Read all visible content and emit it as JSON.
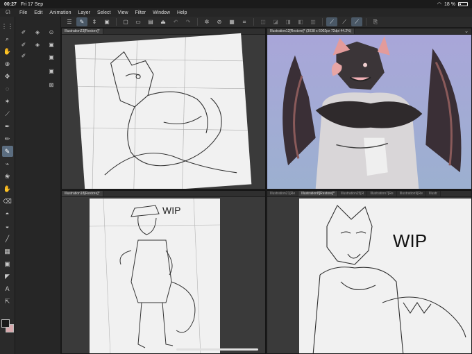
{
  "status": {
    "time": "00:27",
    "date": "Fri 17 Sep",
    "battery": "18 %"
  },
  "menu": [
    "File",
    "Edit",
    "Animation",
    "Layer",
    "Select",
    "View",
    "Filter",
    "Window",
    "Help"
  ],
  "panes": {
    "top_left": {
      "tabs": [
        "Illustration23[Restore]*"
      ]
    },
    "top_right": {
      "tabs": [
        "Illustration12[Restore]* (3038 x 6002px 72dpi 44.2%)"
      ]
    },
    "bottom_left": {
      "tabs": [
        "Illustration18[Restore]*"
      ]
    },
    "bottom_right": {
      "tabs": [
        "Illustration21[Re",
        "Illustration8[Restore]*",
        "Illustration25[R",
        "Illustration7[Re",
        "Illustration9[Re",
        "Illustr"
      ]
    }
  },
  "artwork": {
    "wip_label_1": "WIP",
    "wip_label_2": "WIP"
  },
  "colors": {
    "main_color": "#1a1a1a",
    "sub_color": "#d7a9ad",
    "accent": "#5b6d80",
    "canvas_bg_right": "#9a9fcf"
  }
}
